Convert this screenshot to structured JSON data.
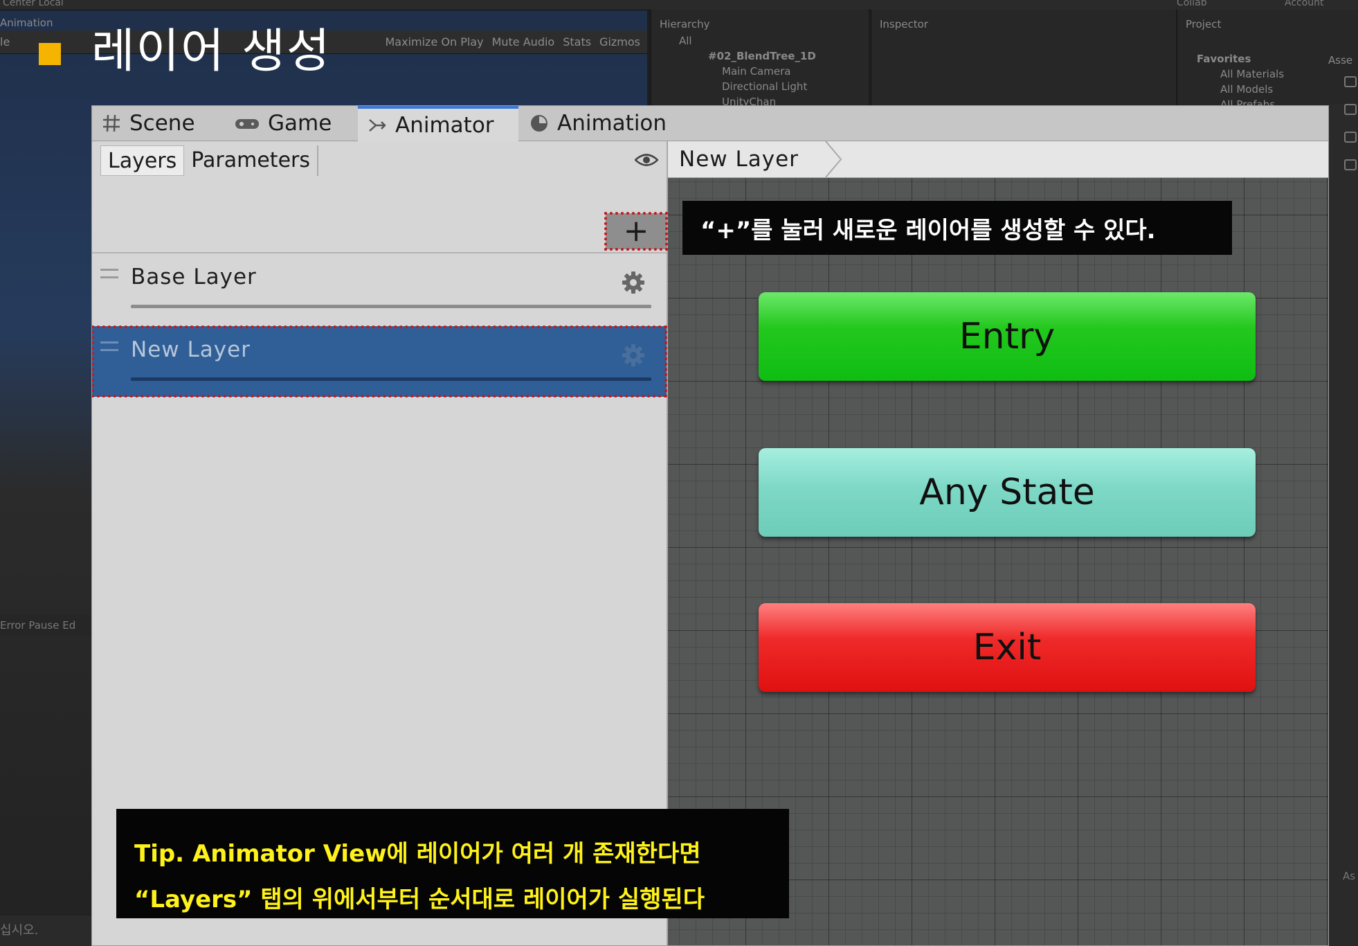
{
  "slide": {
    "title": "레이어 생성"
  },
  "background": {
    "topbar_left": "Center  Local",
    "topbar_right_collab": "Collab",
    "topbar_right_account": "Account",
    "scene_tab": "Animation",
    "scene_sub": "le",
    "toolbar": [
      "Maximize On Play",
      "Mute Audio",
      "Stats",
      "Gizmos"
    ],
    "hierarchy_title": "Hierarchy",
    "hierarchy_search": "All",
    "hierarchy_rows": [
      "#02_BlendTree_1D",
      "Main Camera",
      "Directional Light",
      "UnityChan"
    ],
    "inspector_title": "Inspector",
    "project_title": "Project",
    "project_favorites": "Favorites",
    "project_rows": [
      "All Materials",
      "All Models",
      "All Prefabs"
    ],
    "project_assets": "Asse",
    "console_strip": "Error Pause  Ed",
    "status_text": "십시오.",
    "side_label": "As"
  },
  "animator": {
    "tabs": [
      {
        "label": "Scene",
        "icon": "grid-icon"
      },
      {
        "label": "Game",
        "icon": "gamepad-icon"
      },
      {
        "label": "Animator",
        "icon": "animator-icon",
        "active": true
      },
      {
        "label": "Animation",
        "icon": "clock-icon"
      }
    ],
    "subtabs": [
      "Layers",
      "Parameters"
    ],
    "add_button_label": "+",
    "layers": [
      {
        "name": "Base Layer",
        "selected": false
      },
      {
        "name": "New Layer",
        "selected": true
      }
    ],
    "breadcrumb": "New Layer",
    "states": {
      "entry": "Entry",
      "any_state": "Any State",
      "exit": "Exit"
    }
  },
  "annotations": {
    "hint": "“+”를 눌러 새로운 레이어를 생성할 수 있다.",
    "tip_line1": "Tip. Animator View에 레이어가 여러 개 존재한다면",
    "tip_line2": "“Layers” 탭의 위에서부터 순서대로 레이어가 실행된다"
  },
  "colors": {
    "accent_tab": "#3a79d9",
    "selected_layer": "#2f5f96",
    "highlight_outline": "#c8161d",
    "entry_node": "#0fbd12",
    "any_state_node": "#6ccdb8",
    "exit_node": "#e01010",
    "slide_bullet": "#f5b400",
    "tip_text": "#fff21a"
  }
}
